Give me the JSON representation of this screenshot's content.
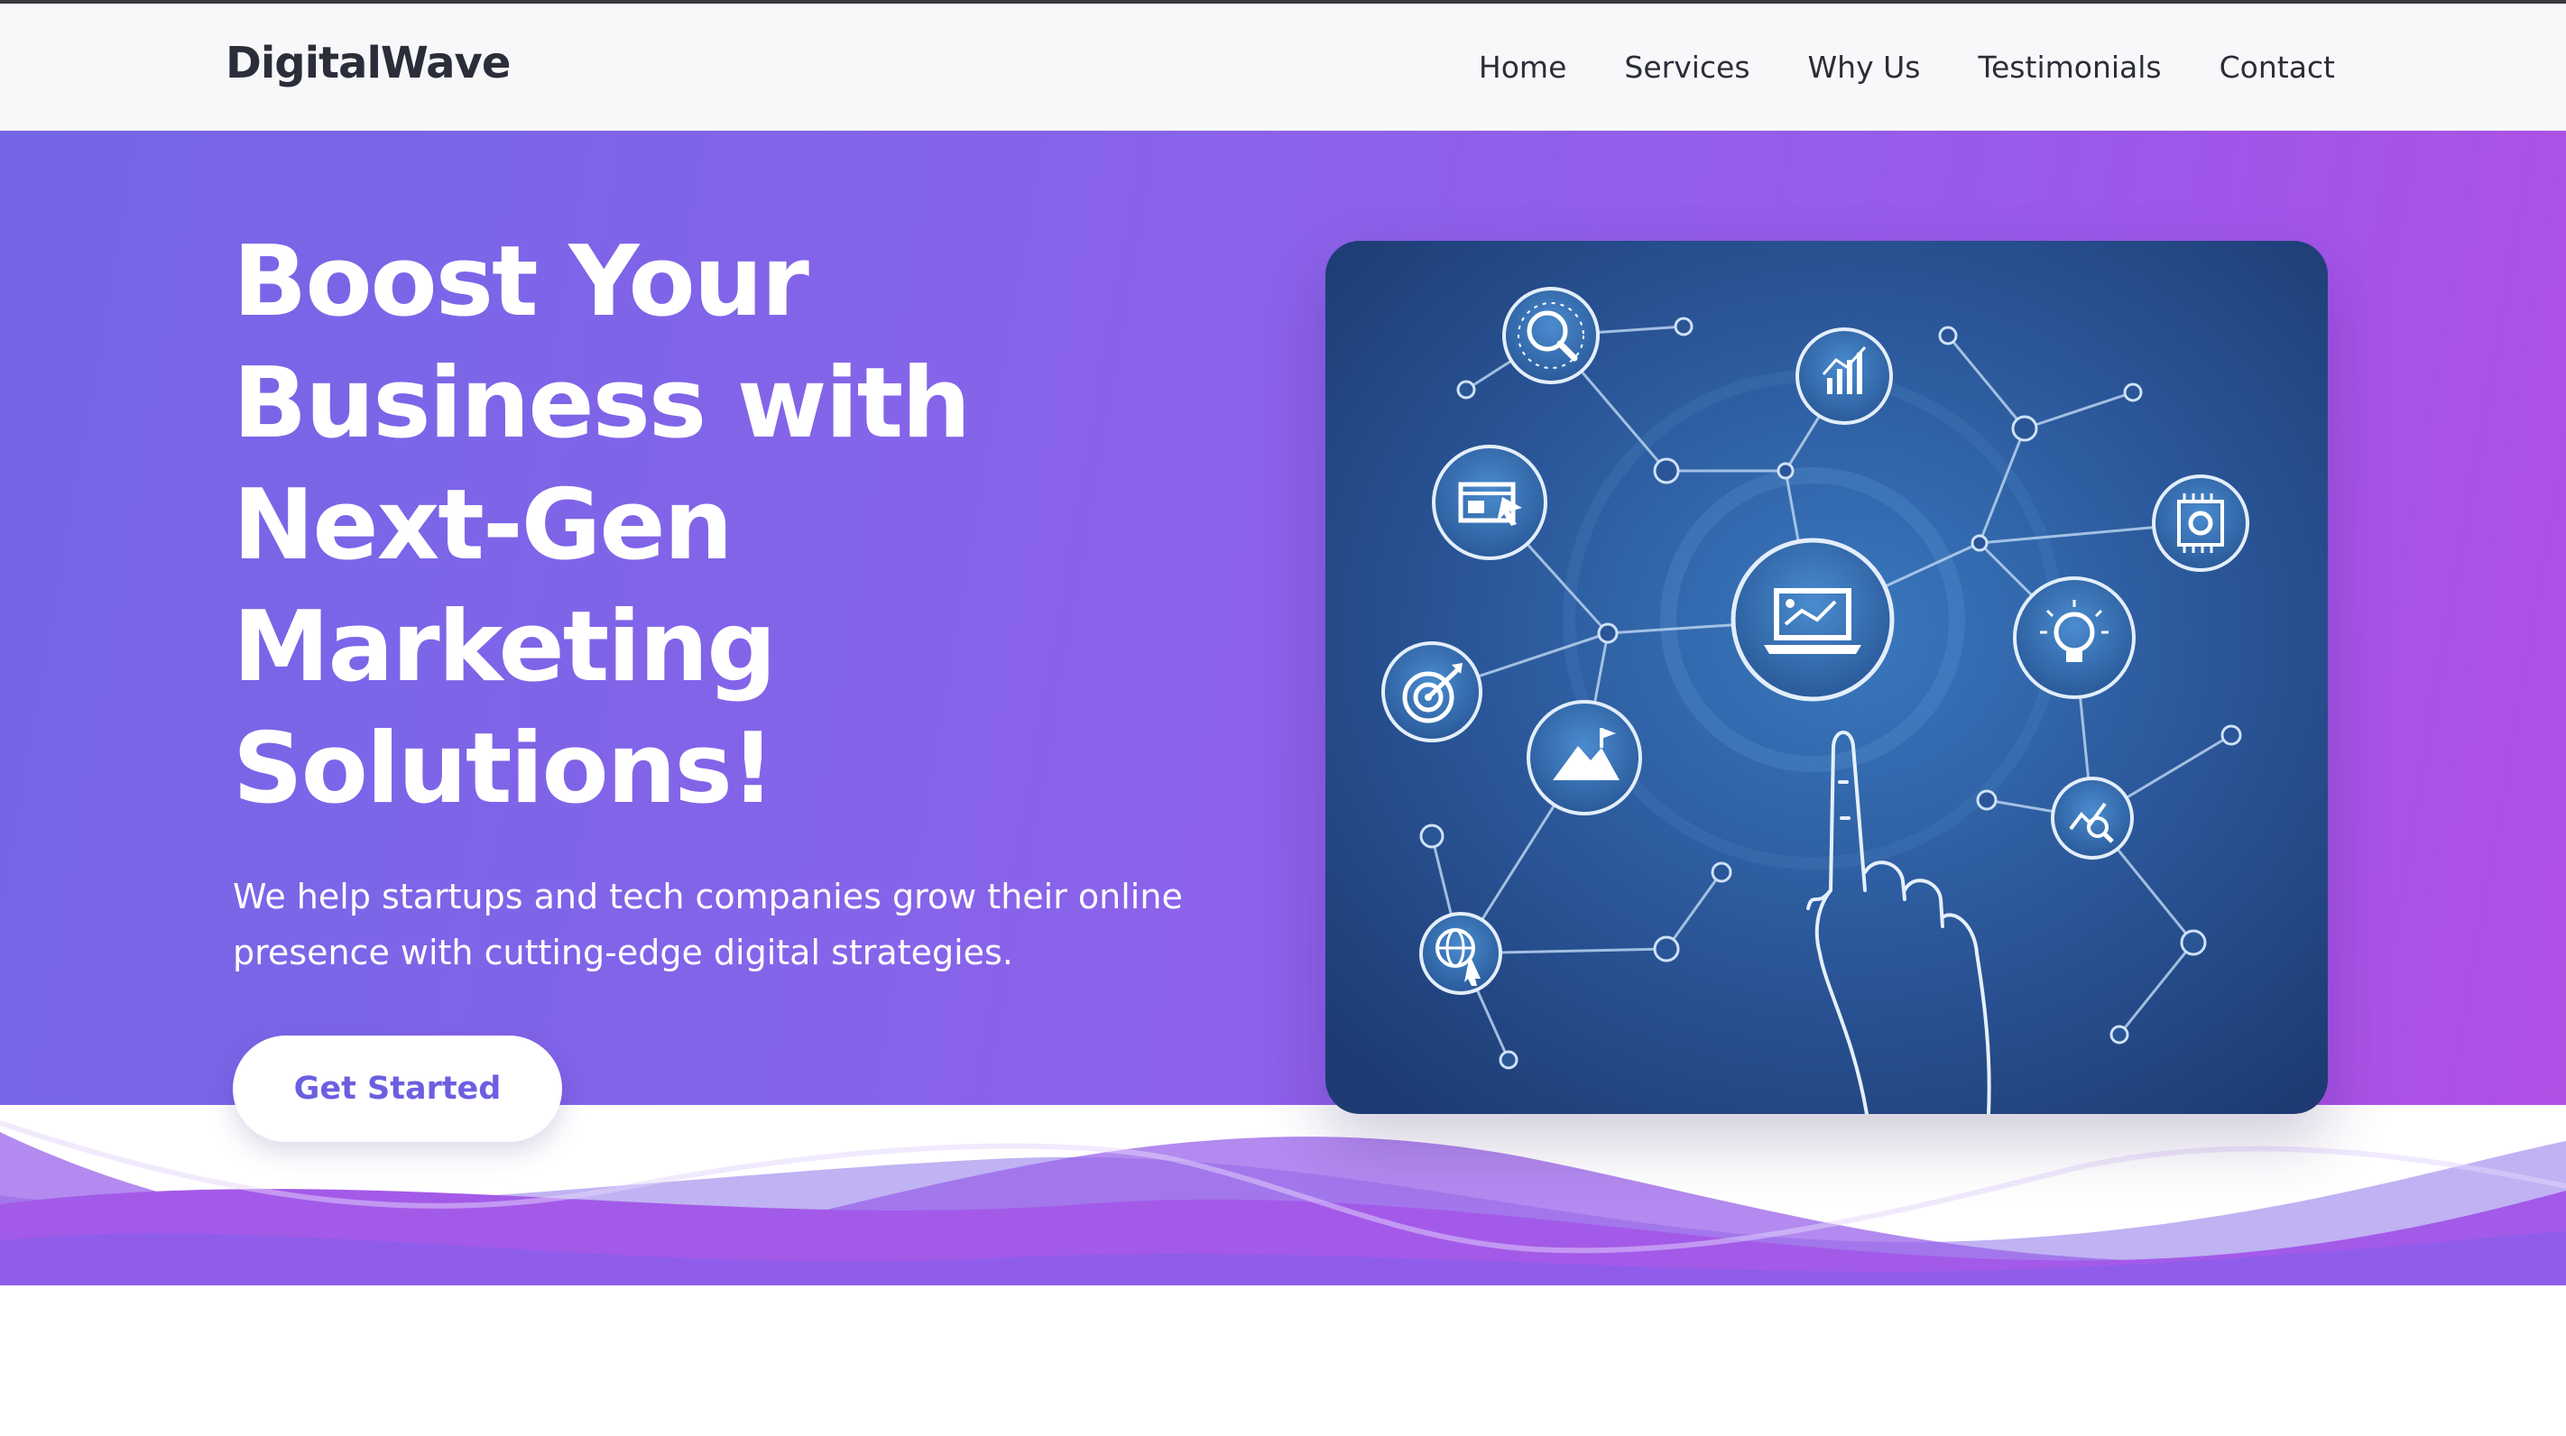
{
  "header": {
    "logo": "DigitalWave",
    "nav": [
      {
        "label": "Home"
      },
      {
        "label": "Services"
      },
      {
        "label": "Why Us"
      },
      {
        "label": "Testimonials"
      },
      {
        "label": "Contact"
      }
    ]
  },
  "hero": {
    "headline_lines": [
      "Boost Your",
      "Business with",
      "Next-Gen",
      "Marketing",
      "Solutions!"
    ],
    "subtext_lines": [
      "We help startups and tech companies grow their online",
      "presence with cutting-edge digital strategies."
    ],
    "cta_label": "Get Started",
    "colors": {
      "gradient_start": "#7466e6",
      "gradient_end": "#b24fe5",
      "accent": "#6c5fe0",
      "illustration_bg": "#2a5597"
    },
    "illustration": {
      "icons": [
        "magnifier-chart-icon",
        "analytics-icon",
        "browser-ad-icon",
        "chip-gear-icon",
        "target-icon",
        "laptop-presentation-icon",
        "lightbulb-gear-icon",
        "mountain-flag-icon",
        "chart-search-icon",
        "globe-cursor-icon",
        "hand-touch-icon"
      ]
    }
  }
}
